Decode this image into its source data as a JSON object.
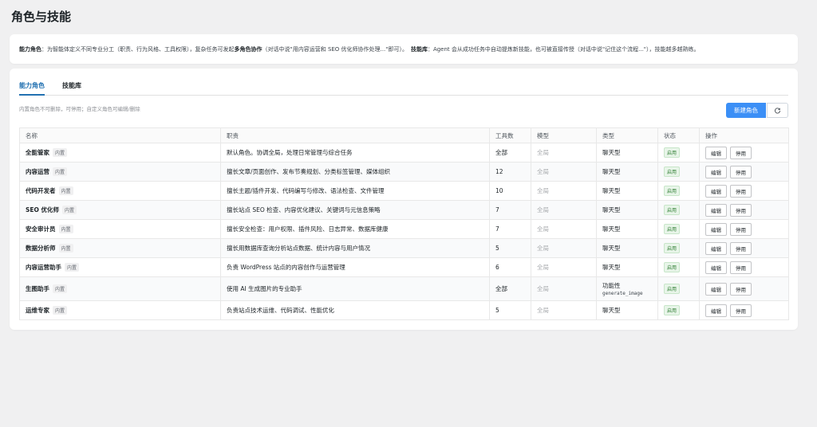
{
  "page_title": "角色与技能",
  "info": {
    "p1_label": "能力角色",
    "p1_text_a": "：为智能体定义不同专业分工（职责、行为风格、工具权限），复杂任务可发起",
    "p1_bold": "多角色协作",
    "p1_text_b": "（对话中说\"用内容运营和 SEO 优化师协作处理...\"即可）。",
    "p2_label": "技能库",
    "p2_text": "：Agent 会从成功任务中自动提炼新技能，也可被直接传授（对话中说\"记住这个流程...\"），技能越多越熟练。"
  },
  "tabs": [
    {
      "label": "能力角色",
      "active": true
    },
    {
      "label": "技能库",
      "active": false
    }
  ],
  "hint": "内置角色不可删除，可停用；自定义角色可编辑/删除",
  "actions": {
    "new_role": "新建角色",
    "refresh_icon": "refresh-icon"
  },
  "table": {
    "columns": [
      "名称",
      "职责",
      "工具数",
      "模型",
      "类型",
      "状态",
      "操作"
    ],
    "builtin_label": "内置",
    "edit_label": "编辑",
    "disable_label": "停用",
    "rows": [
      {
        "name": "全能管家",
        "duty": "默认角色。协调全局，处理日常管理与综合任务",
        "tools": "全部",
        "model": "全局",
        "type": "聊天型",
        "type_sub": "",
        "status": "启用"
      },
      {
        "name": "内容运营",
        "duty": "擅长文章/页面创作、发布节奏规划、分类标签管理、媒体组织",
        "tools": "12",
        "model": "全局",
        "type": "聊天型",
        "type_sub": "",
        "status": "启用"
      },
      {
        "name": "代码开发者",
        "duty": "擅长主题/插件开发、代码编写与修改、语法检查、文件管理",
        "tools": "10",
        "model": "全局",
        "type": "聊天型",
        "type_sub": "",
        "status": "启用"
      },
      {
        "name": "SEO 优化师",
        "duty": "擅长站点 SEO 检查、内容优化建议、关键词与元信息策略",
        "tools": "7",
        "model": "全局",
        "type": "聊天型",
        "type_sub": "",
        "status": "启用"
      },
      {
        "name": "安全审计员",
        "duty": "擅长安全检查：用户权限、插件风险、日志异常、数据库健康",
        "tools": "7",
        "model": "全局",
        "type": "聊天型",
        "type_sub": "",
        "status": "启用"
      },
      {
        "name": "数据分析师",
        "duty": "擅长用数据库查询分析站点数据、统计内容与用户情况",
        "tools": "5",
        "model": "全局",
        "type": "聊天型",
        "type_sub": "",
        "status": "启用"
      },
      {
        "name": "内容运营助手",
        "duty": "负责 WordPress 站点的内容创作与运营管理",
        "tools": "6",
        "model": "全局",
        "type": "聊天型",
        "type_sub": "",
        "status": "启用"
      },
      {
        "name": "生图助手",
        "duty": "使用 AI 生成图片的专业助手",
        "tools": "全部",
        "model": "全局",
        "type": "功能性",
        "type_sub": "generate_image",
        "status": "启用"
      },
      {
        "name": "运维专家",
        "duty": "负责站点技术运维、代码调试、性能优化",
        "tools": "5",
        "model": "全局",
        "type": "聊天型",
        "type_sub": "",
        "status": "启用"
      }
    ]
  }
}
